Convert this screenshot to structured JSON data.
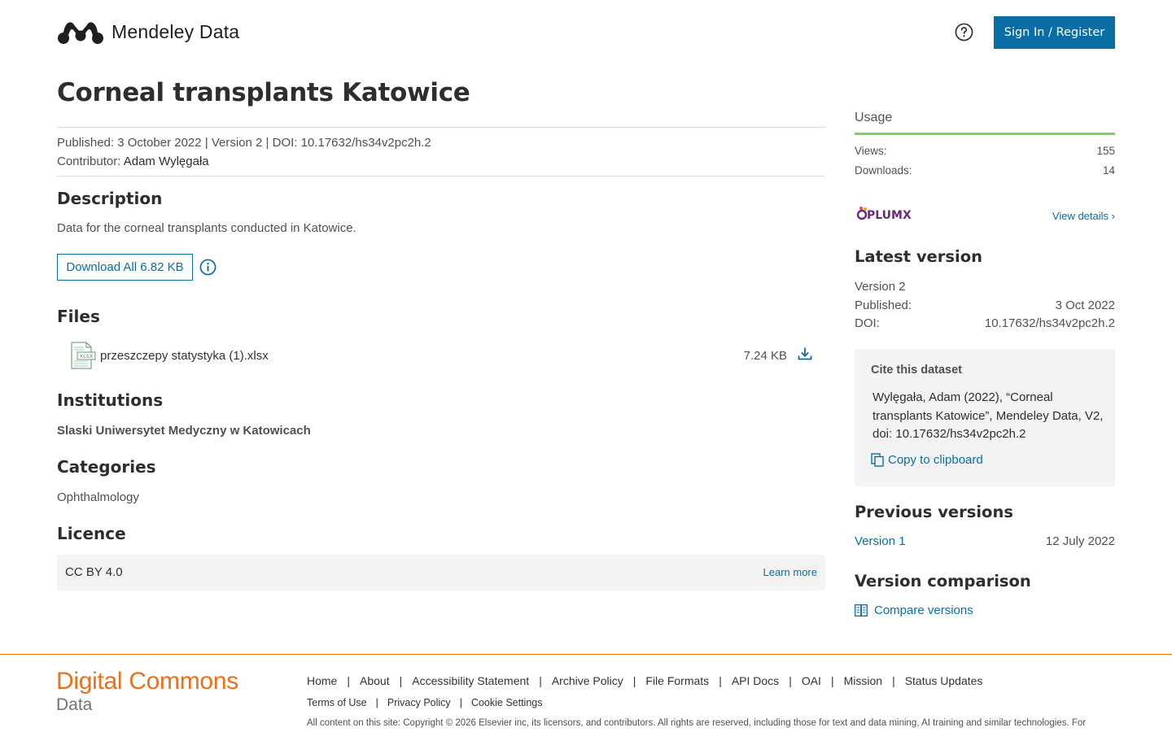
{
  "header": {
    "brand": "Mendeley Data",
    "signin_label": "Sign In / Register",
    "accent_color": "#0a6ea4"
  },
  "dataset": {
    "title": "Corneal transplants Katowice",
    "meta_line": "Published: 3 October 2022 | Version 2 | DOI: 10.17632/hs34v2pc2h.2",
    "contributor_label": "Contributor:",
    "contributor_name": "Adam Wylęgała"
  },
  "description": {
    "heading": "Description",
    "text": "Data for the corneal transplants conducted in Katowice.",
    "download_label": "Download All 6.82 KB"
  },
  "files": {
    "heading": "Files",
    "items": [
      {
        "name": "przeszczepy statystyka (1).xlsx",
        "size": "7.24 KB",
        "type_badge": "XLSX"
      }
    ]
  },
  "institutions": {
    "heading": "Institutions",
    "items": [
      "Slaski Uniwersytet Medyczny w Katowicach"
    ]
  },
  "categories": {
    "heading": "Categories",
    "items": [
      "Ophthalmology"
    ]
  },
  "licence": {
    "heading": "Licence",
    "name": "CC BY 4.0",
    "learn_more": "Learn more"
  },
  "usage": {
    "heading": "Usage",
    "views_label": "Views:",
    "views": "155",
    "downloads_label": "Downloads:",
    "downloads": "14",
    "plumx": "PLUMX",
    "view_details": "View details",
    "accent_color": "#7bd35c"
  },
  "latest_version": {
    "heading": "Latest version",
    "version": "Version 2",
    "published_label": "Published:",
    "published": "3 Oct 2022",
    "doi_label": "DOI:",
    "doi": "10.17632/hs34v2pc2h.2"
  },
  "cite": {
    "heading": "Cite this dataset",
    "text": "Wylęgała, Adam (2022), “Corneal transplants Katowice”, Mendeley Data, V2, doi: 10.17632/hs34v2pc2h.2",
    "copy_label": "Copy to clipboard"
  },
  "previous_versions": {
    "heading": "Previous versions",
    "items": [
      {
        "label": "Version 1",
        "date": "12 July 2022"
      }
    ]
  },
  "version_comparison": {
    "heading": "Version comparison",
    "compare_label": "Compare versions"
  },
  "footer": {
    "logo_line1": "Digital Commons",
    "logo_line2": "Data",
    "accent_color": "#e9711c",
    "nav": [
      "Home",
      "About",
      "Accessibility Statement",
      "Archive Policy",
      "File Formats",
      "API Docs",
      "OAI",
      "Mission",
      "Status Updates"
    ],
    "nav2": [
      "Terms of Use",
      "Privacy Policy",
      "Cookie Settings"
    ],
    "copyright": "All content on this site: Copyright © 2026 Elsevier inc, its licensors, and contributors. All rights are reserved, including those for text and data mining, AI training and similar technologies. For"
  }
}
